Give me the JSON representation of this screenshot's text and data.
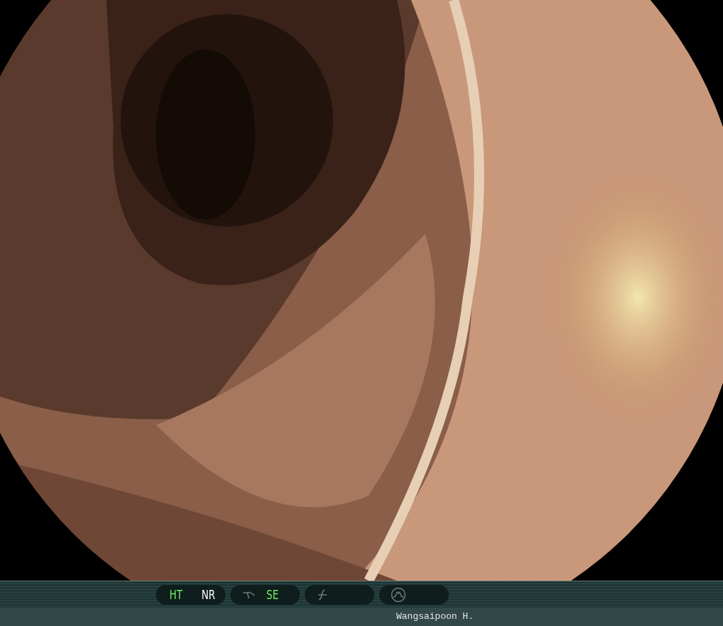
{
  "mode_bar": {
    "pills": [
      {
        "kind": "plain",
        "labels": [
          {
            "text": "HT",
            "on": true
          },
          {
            "text": "NR",
            "on": false
          }
        ]
      },
      {
        "kind": "curve",
        "labels": [
          {
            "text": "SE",
            "on": true
          }
        ]
      },
      {
        "kind": "slash"
      },
      {
        "kind": "wave"
      }
    ]
  },
  "footer": {
    "operator": "Wangsaipoon H."
  }
}
